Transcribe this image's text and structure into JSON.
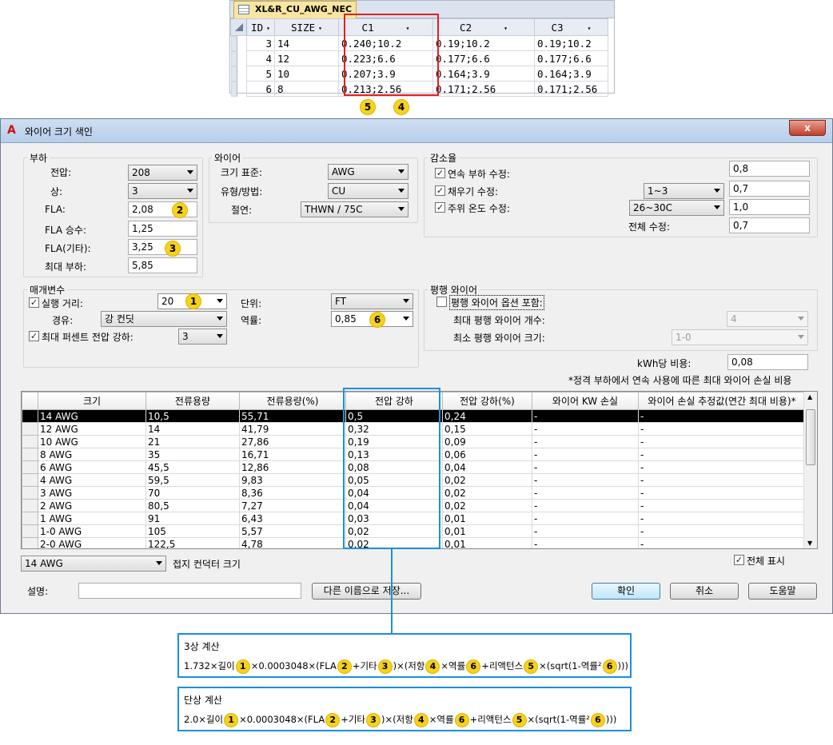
{
  "top_table": {
    "tab_title": "XL&R_CU_AWG_NEC",
    "columns": [
      "ID",
      "SIZE",
      "C1",
      "C2",
      "C3"
    ],
    "rows": [
      {
        "id": "3",
        "size": "14",
        "c1": "0.240;10.2",
        "c2": "0.19;10.2",
        "c3": "0.19;10.2"
      },
      {
        "id": "4",
        "size": "12",
        "c1": "0.223;6.6",
        "c2": "0.177;6.6",
        "c3": "0.177;6.6"
      },
      {
        "id": "5",
        "size": "10",
        "c1": "0.207;3.9",
        "c2": "0.164;3.9",
        "c3": "0.164;3.9"
      },
      {
        "id": "6",
        "size": "8",
        "c1": "0.213;2.56",
        "c2": "0.171;2.56",
        "c3": "0.171;2.56"
      }
    ],
    "badges": [
      "5",
      "4"
    ]
  },
  "dialog": {
    "title": "와이어 크기 색인",
    "close_label": "x",
    "load": {
      "group": "부하",
      "voltage_label": "전압:",
      "voltage_value": "208",
      "phase_label": "상:",
      "phase_value": "3",
      "fla_label": "FLA:",
      "fla_value": "2,08",
      "fla_mult_label": "FLA 승수:",
      "fla_mult_value": "1,25",
      "fla_other_label": "FLA(기타):",
      "fla_other_value": "3,25",
      "max_load_label": "최대 부하:",
      "max_load_value": "5,85",
      "badge_fla": "2",
      "badge_other": "3"
    },
    "wire": {
      "group": "와이어",
      "size_std_label": "크기 표준:",
      "size_std_value": "AWG",
      "type_label": "유형/방법:",
      "type_value": "CU",
      "insulation_label": "절연:",
      "insulation_value": "THWN / 75C"
    },
    "derating": {
      "group": "감소율",
      "continuous_label": "연속 부하 수정:",
      "continuous_value": "0,8",
      "fill_label": "채우기 수정:",
      "fill_select": "1~3",
      "fill_value": "0,7",
      "ambient_label": "주위 온도 수정:",
      "ambient_select": "26~30C",
      "ambient_value": "1,0",
      "total_label": "전체 수정:",
      "total_value": "0,7"
    },
    "params": {
      "group": "매개변수",
      "run_label": "실행 거리:",
      "run_value": "20",
      "badge_run": "1",
      "raceway_label": "경유:",
      "raceway_value": "강 컨딧",
      "max_vd_label": "최대 퍼센트 전압 강하:",
      "max_vd_value": "3",
      "unit_label": "단위:",
      "unit_value": "FT",
      "pf_label": "역률:",
      "pf_value": "0,85",
      "badge_pf": "6"
    },
    "parallel": {
      "group": "평행 와이어",
      "include_label": "평행 와이어 옵션 포함:",
      "max_count_label": "최대 평행 와이어 개수:",
      "max_count_value": "4",
      "min_size_label": "최소 평행 와이어 크기:",
      "min_size_value": "1-0"
    },
    "kwh_label": "kWh당 비용:",
    "kwh_value": "0,08",
    "note": "*정격 부하에서 연속 사용에 따른 최대 와이어 손실 비용",
    "grid": {
      "columns": [
        "크기",
        "전류용량",
        "전류용량(%)",
        "전압 강하",
        "전압 강하(%)",
        "와이어 KW 손실",
        "와이어 손실 추정값(연간 최대 비용)*"
      ],
      "rows": [
        [
          "14 AWG",
          "10,5",
          "55,71",
          "0,5",
          "0,24",
          "-",
          "-"
        ],
        [
          "12 AWG",
          "14",
          "41,79",
          "0,32",
          "0,15",
          "-",
          "-"
        ],
        [
          "10 AWG",
          "21",
          "27,86",
          "0,19",
          "0,09",
          "-",
          "-"
        ],
        [
          "8 AWG",
          "35",
          "16,71",
          "0,13",
          "0,06",
          "-",
          "-"
        ],
        [
          "6 AWG",
          "45,5",
          "12,86",
          "0,08",
          "0,04",
          "-",
          "-"
        ],
        [
          "4 AWG",
          "59,5",
          "9,83",
          "0,05",
          "0,02",
          "-",
          "-"
        ],
        [
          "3 AWG",
          "70",
          "8,36",
          "0,04",
          "0,02",
          "-",
          "-"
        ],
        [
          "2 AWG",
          "80,5",
          "7,27",
          "0,04",
          "0,02",
          "-",
          "-"
        ],
        [
          "1 AWG",
          "91",
          "6,43",
          "0,03",
          "0,01",
          "-",
          "-"
        ],
        [
          "1-0 AWG",
          "105",
          "5,57",
          "0,02",
          "0,01",
          "-",
          "-"
        ],
        [
          "2-0 AWG",
          "122,5",
          "4,78",
          "0,02",
          "0,01",
          "-",
          "-"
        ]
      ]
    },
    "ground_select": "14 AWG",
    "ground_label": "접지 컨덕터 크기",
    "show_all_label": "전체 표시",
    "desc_label": "설명:",
    "saveas_label": "다른 이름으로 저장...",
    "ok_label": "확인",
    "cancel_label": "취소",
    "help_label": "도움말"
  },
  "formula_3": {
    "title": "3상 계산",
    "parts": [
      "1.732×길이",
      "×0.0003048×(FLA",
      "+기타",
      ")×(저항",
      "×역률",
      "+리액턴스",
      "×(sqrt(1-역률²",
      ")))"
    ]
  },
  "formula_1": {
    "title": "단상 계산",
    "parts": [
      "2.0×길이",
      "×0.0003048×(FLA",
      "+기타",
      ")×(저항",
      "×역률",
      "+리액턴스",
      "×(sqrt(1-역률²",
      ")))"
    ]
  }
}
